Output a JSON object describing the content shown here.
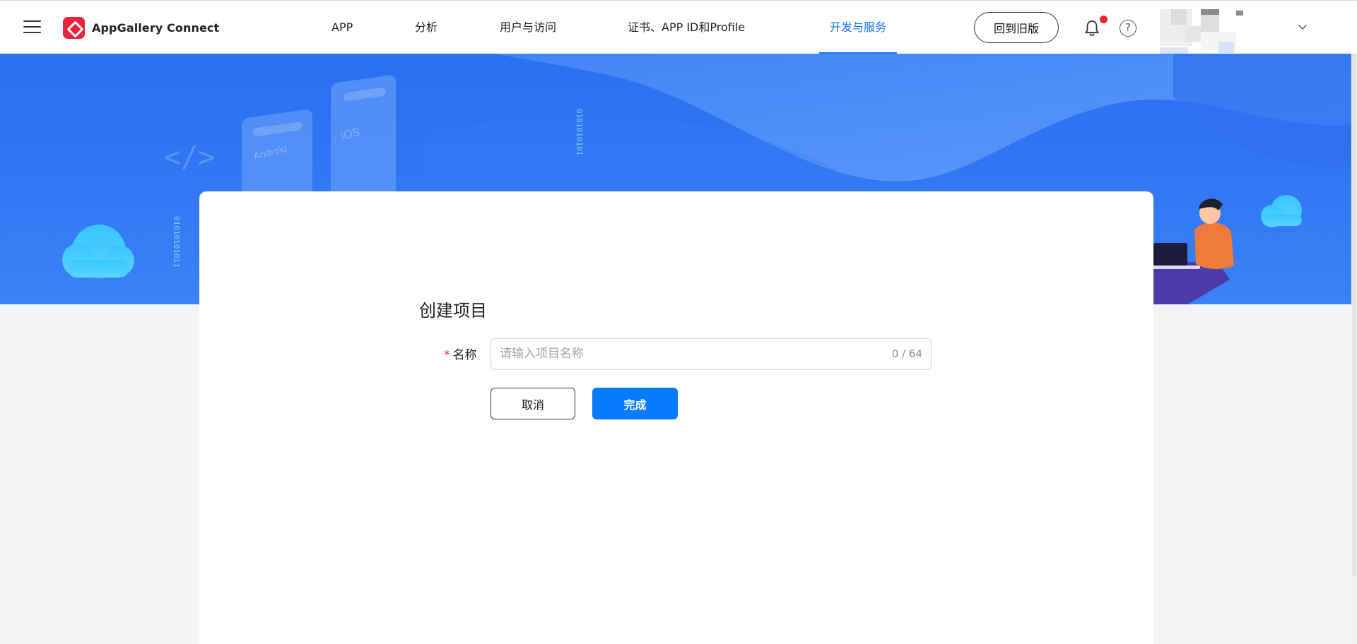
{
  "header": {
    "brand_name": "AppGallery Connect",
    "nav": [
      {
        "label": "APP"
      },
      {
        "label": "分析"
      },
      {
        "label": "用户与访问"
      },
      {
        "label": "证书、APP ID和Profile"
      },
      {
        "label": "开发与服务",
        "active": true
      }
    ],
    "old_version_label": "回到旧版",
    "help_glyph": "?"
  },
  "banner": {
    "card_labels": [
      "Android",
      "iOS"
    ],
    "code_glyph": "</>"
  },
  "form": {
    "title": "创建项目",
    "required_mark": "*",
    "name_label": "名称",
    "name_value": "",
    "name_placeholder": "请输入项目名称",
    "counter": "0 / 64",
    "cancel_label": "取消",
    "done_label": "完成"
  },
  "colors": {
    "accent": "#1677ff",
    "primary_button": "#0a7bff",
    "brand": "#e8243c",
    "banner": "#2f74f2",
    "notification_dot": "#f5222d"
  },
  "icons": [
    "menu-icon",
    "appgallery-logo-icon",
    "bell-icon",
    "help-icon",
    "chevron-down-icon"
  ]
}
